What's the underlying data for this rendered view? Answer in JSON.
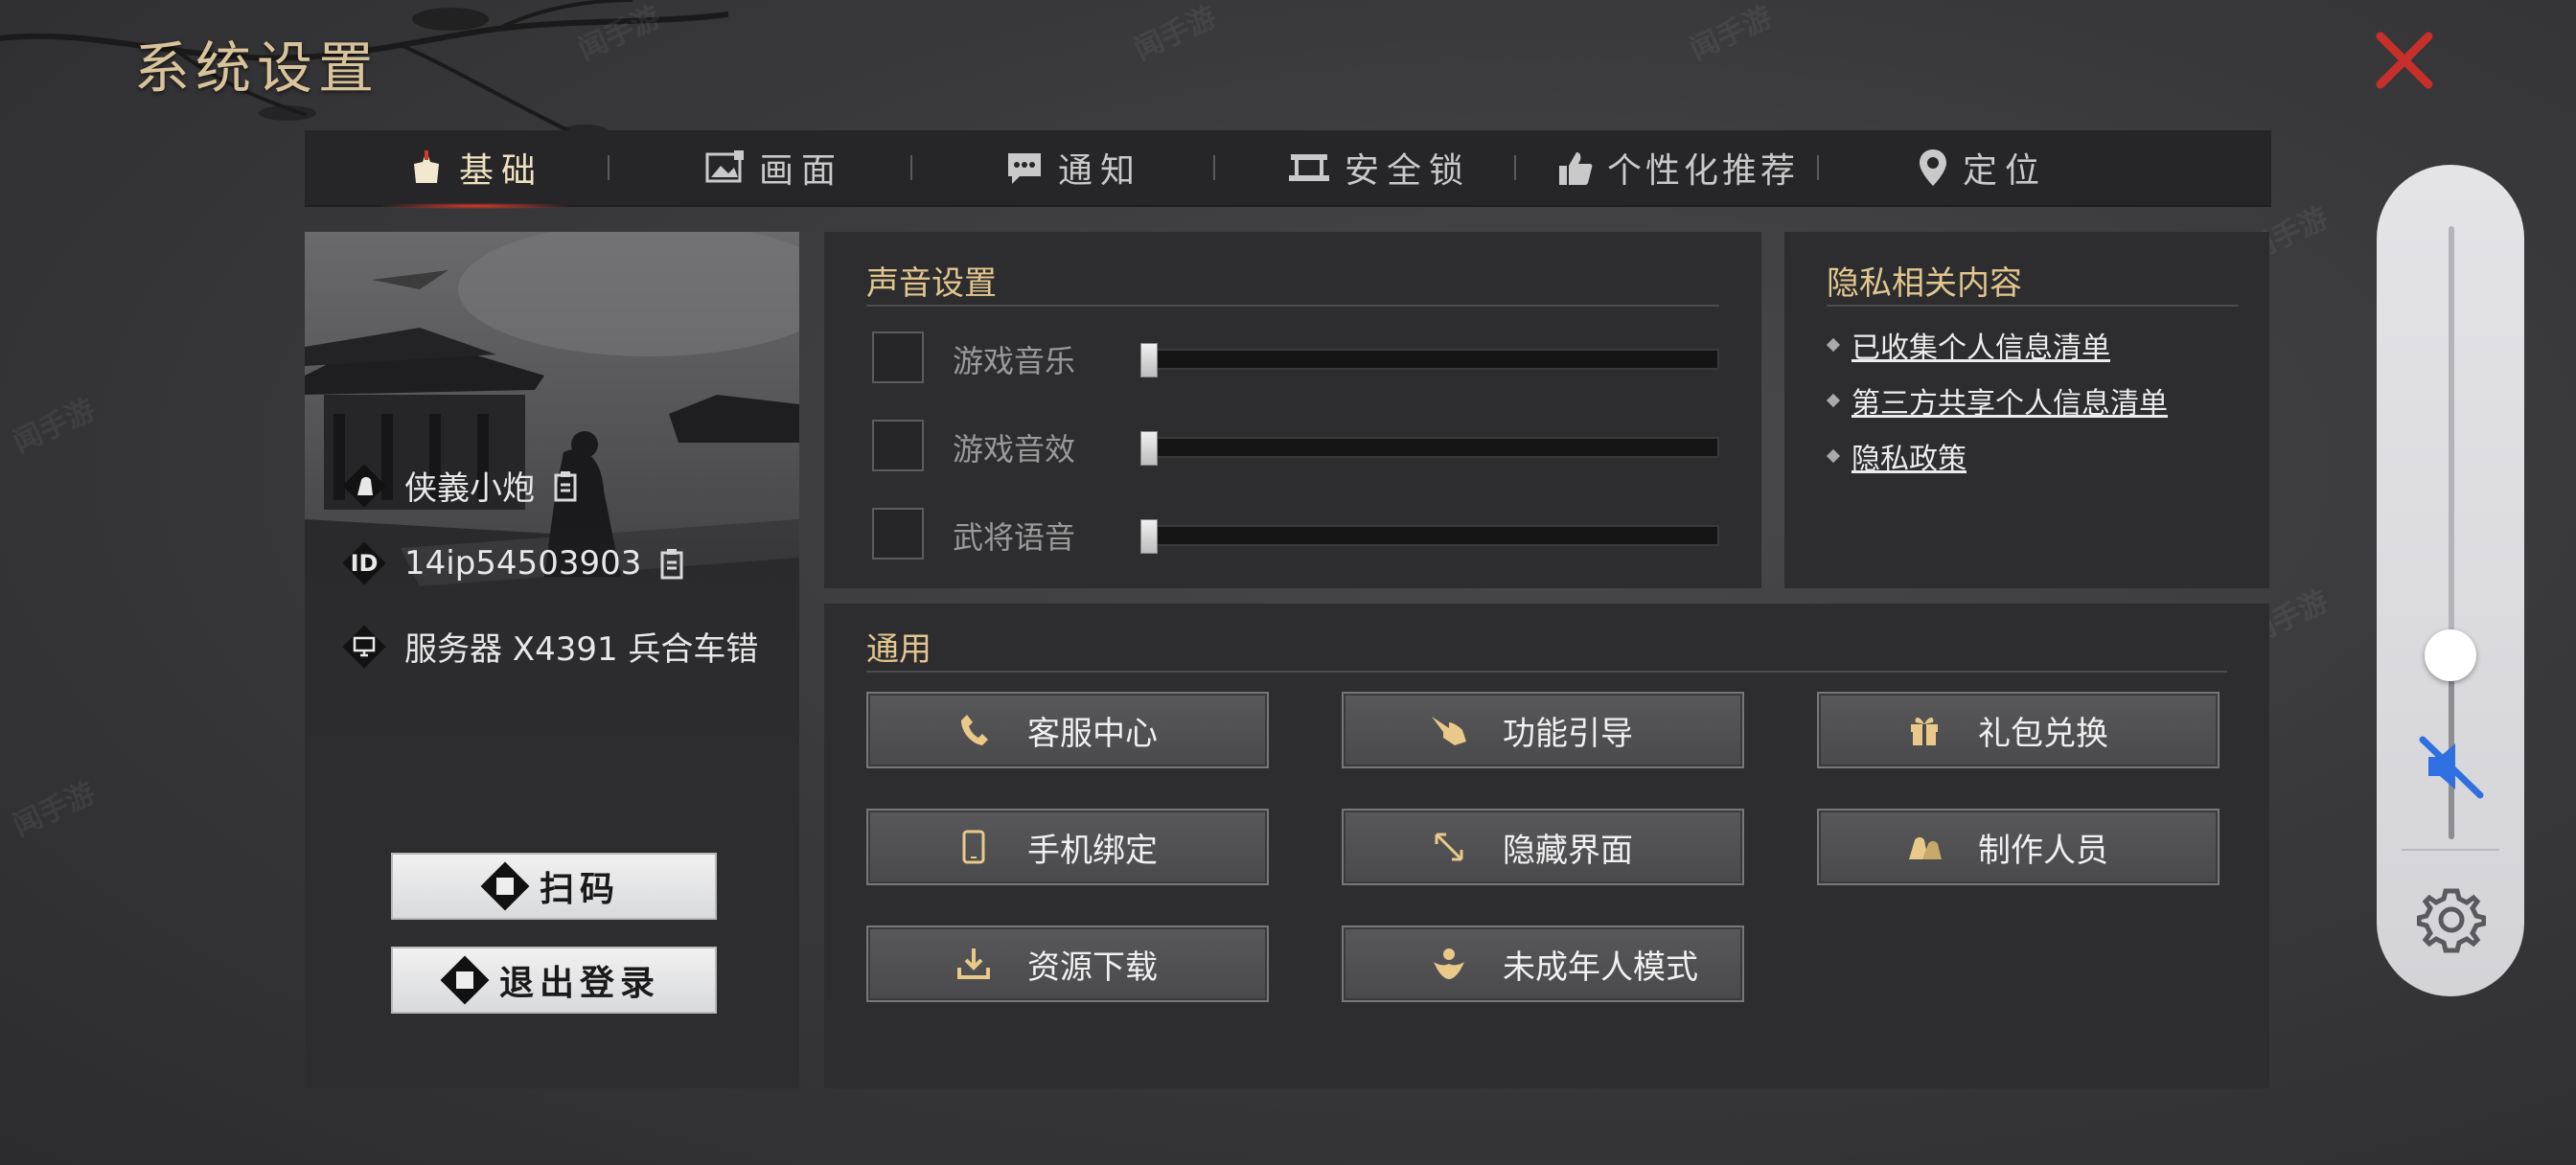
{
  "app": {
    "title": "系统设置"
  },
  "tabs": [
    {
      "label": "基础",
      "icon": "helmet-icon",
      "active": true
    },
    {
      "label": "画面",
      "icon": "image-icon"
    },
    {
      "label": "通知",
      "icon": "chat-icon"
    },
    {
      "label": "安全锁",
      "icon": "lock-icon"
    },
    {
      "label": "个性化推荐",
      "icon": "thumbs-up-icon"
    },
    {
      "label": "定位",
      "icon": "location-pin-icon"
    }
  ],
  "profile": {
    "name": "侠義小炮",
    "id_badge": "ID",
    "id": "14ip54503903",
    "server": "服务器 X4391 兵合车错",
    "scan_label": "扫码",
    "logout_label": "退出登录"
  },
  "sound": {
    "title": "声音设置",
    "rows": [
      {
        "label": "游戏音乐",
        "checked": false,
        "level": 0.0
      },
      {
        "label": "游戏音效",
        "checked": false,
        "level": 0.0
      },
      {
        "label": "武将语音",
        "checked": false,
        "level": 0.0
      }
    ]
  },
  "privacy": {
    "title": "隐私相关内容",
    "links": [
      "已收集个人信息清单",
      "第三方共享个人信息清单",
      "隐私政策"
    ]
  },
  "general": {
    "title": "通用",
    "buttons": [
      {
        "label": "客服中心",
        "icon": "phone-icon"
      },
      {
        "label": "功能引导",
        "icon": "pointing-hand-icon"
      },
      {
        "label": "礼包兑换",
        "icon": "gift-icon"
      },
      {
        "label": "手机绑定",
        "icon": "mobile-icon"
      },
      {
        "label": "隐藏界面",
        "icon": "resize-arrow-icon"
      },
      {
        "label": "制作人员",
        "icon": "team-icon"
      },
      {
        "label": "资源下载",
        "icon": "download-icon"
      },
      {
        "label": "未成年人模式",
        "icon": "child-mode-icon"
      }
    ]
  },
  "system_volume": {
    "level": 0.3,
    "muted": true
  },
  "colors": {
    "accent_gold": "#e2c68e",
    "close_red": "#d0332b",
    "tab_active_glow": "#e23a2a",
    "mute_blue": "#2f6fe0"
  }
}
